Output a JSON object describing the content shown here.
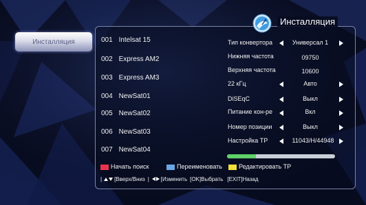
{
  "colors": {
    "accent_red": "#e8334f",
    "accent_blue": "#6aa7e6",
    "accent_yellow": "#f2e03a",
    "progress_green": "#5fd06a"
  },
  "window": {
    "title": "Инсталляция",
    "icon": "satellite-dish-icon"
  },
  "sidebar": {
    "items": [
      {
        "label": "Инсталляция",
        "selected": true
      }
    ]
  },
  "satellites": [
    {
      "num": "001",
      "name": "Intelsat 15"
    },
    {
      "num": "002",
      "name": "Express AM2"
    },
    {
      "num": "003",
      "name": "Express AM3"
    },
    {
      "num": "004",
      "name": "NewSat01"
    },
    {
      "num": "005",
      "name": "NewSat02"
    },
    {
      "num": "006",
      "name": "NewSat03"
    },
    {
      "num": "007",
      "name": "NewSat04"
    }
  ],
  "params": [
    {
      "label": "Тип конвертора",
      "value": "Универсал 1"
    },
    {
      "label": "Нижняя частота",
      "value": "09750"
    },
    {
      "label": "Верхняя частота",
      "value": "10600"
    },
    {
      "label": "22 кГц",
      "value": "Авто"
    },
    {
      "label": "DiSEqC",
      "value": "Выкл"
    },
    {
      "label": "Питание кон-ре",
      "value": "Вкл"
    },
    {
      "label": "Номер позиции",
      "value": "Выкл"
    },
    {
      "label": "Настройка ТР",
      "value": "11043/H/44948"
    }
  ],
  "signal": {
    "level": 0.27
  },
  "legend": {
    "red": "Начать поиск",
    "blue": "Переименовать",
    "yellow": "Редактировать ТР"
  },
  "help": {
    "nav": "[Вверх/Вниз",
    "change": "[Изменить",
    "ok": "[OK]Выбрать",
    "exit": "[EXIT]Назад"
  }
}
